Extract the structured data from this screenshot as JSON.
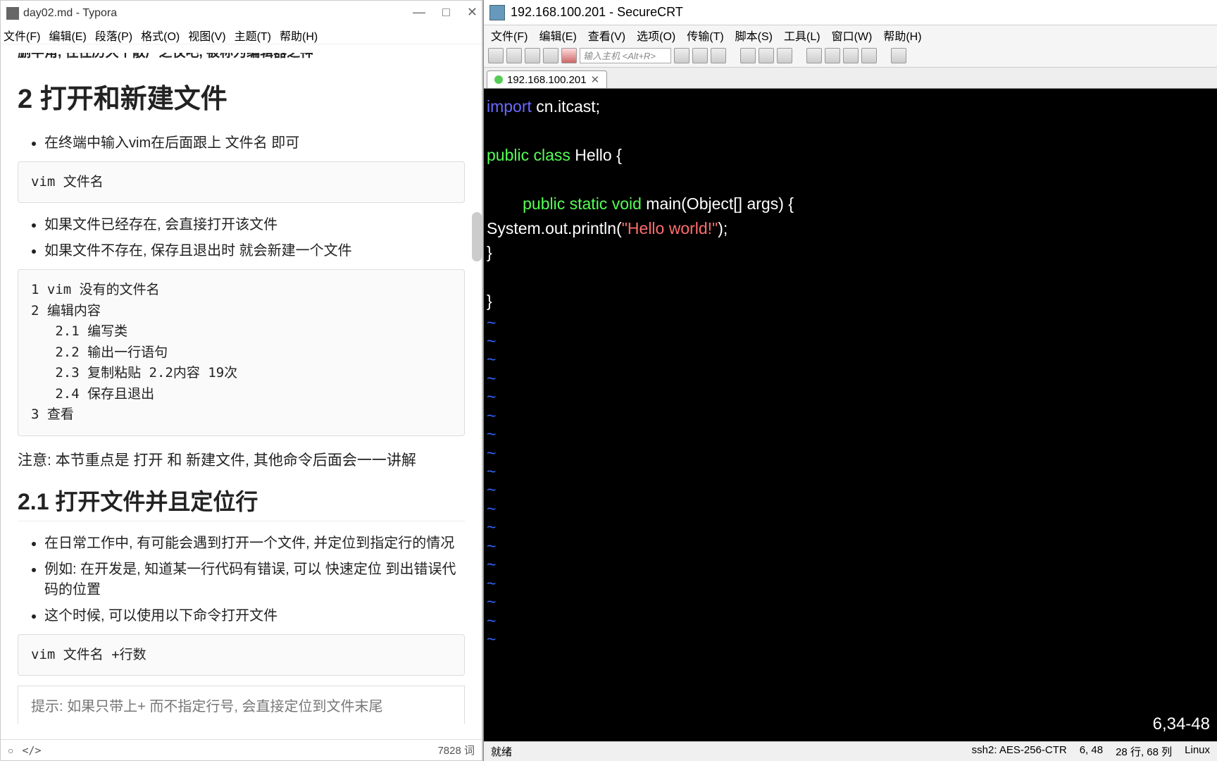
{
  "typora": {
    "title": "day02.md - Typora",
    "menu": [
      "文件(F)",
      "编辑(E)",
      "段落(P)",
      "格式(O)",
      "视图(V)",
      "主题(T)",
      "帮助(H)"
    ],
    "sys": {
      "min": "—",
      "max": "□",
      "close": "✕"
    },
    "cut_line": "删半角, 往往历久个散广之仅吧, 被称为编辑器之神",
    "h2": "2 打开和新建文件",
    "li1": "在终端中输入vim在后面跟上 文件名 即可",
    "code1": "vim 文件名",
    "li2": "如果文件已经存在, 会直接打开该文件",
    "li3": "如果文件不存在, 保存且退出时 就会新建一个文件",
    "code2": "1 vim 没有的文件名\n2 编辑内容\n   2.1 编写类\n   2.2 输出一行语句\n   2.3 复制粘贴 2.2内容 19次\n   2.4 保存且退出\n3 查看",
    "note": "注意: 本节重点是 打开 和 新建文件, 其他命令后面会一一讲解",
    "h3": "2.1 打开文件并且定位行",
    "li4": "在日常工作中, 有可能会遇到打开一个文件, 并定位到指定行的情况",
    "li5": "例如: 在开发是, 知道某一行代码有错误, 可以 快速定位 到出错误代码的位置",
    "li6": "这个时候, 可以使用以下命令打开文件",
    "code3": "vim 文件名 +行数",
    "tip": "提示: 如果只带上+ 而不指定行号, 会直接定位到文件末尾",
    "status_left_circ": "○",
    "status_left_code": "</>",
    "status_right": "7828 词"
  },
  "crt": {
    "title": "192.168.100.201 - SecureCRT",
    "menu": [
      "文件(F)",
      "编辑(E)",
      "查看(V)",
      "选项(O)",
      "传输(T)",
      "脚本(S)",
      "工具(L)",
      "窗口(W)",
      "帮助(H)"
    ],
    "host_placeholder": "输入主机 <Alt+R>",
    "tab": "192.168.100.201",
    "close": "✕",
    "code": {
      "l1a": "import",
      "l1b": " cn.itcast;",
      "l2a": "public",
      "l2b": "class",
      "l2c": " Hello {",
      "l3a": "public",
      "l3b": "static",
      "l3c": "void",
      "l3d": " main(Object[] args) {",
      "l4a": "                System.out.println(",
      "l4b": "\"Hello world!\"",
      "l4c": ");",
      "l5": "        }",
      "l6": "}",
      "tilde": "~"
    },
    "pos": "6,34-48",
    "status": {
      "ready": "就绪",
      "ssh": "ssh2: AES-256-CTR",
      "rc": "6, 48",
      "size": "28 行, 68 列",
      "os": "Linux"
    }
  }
}
